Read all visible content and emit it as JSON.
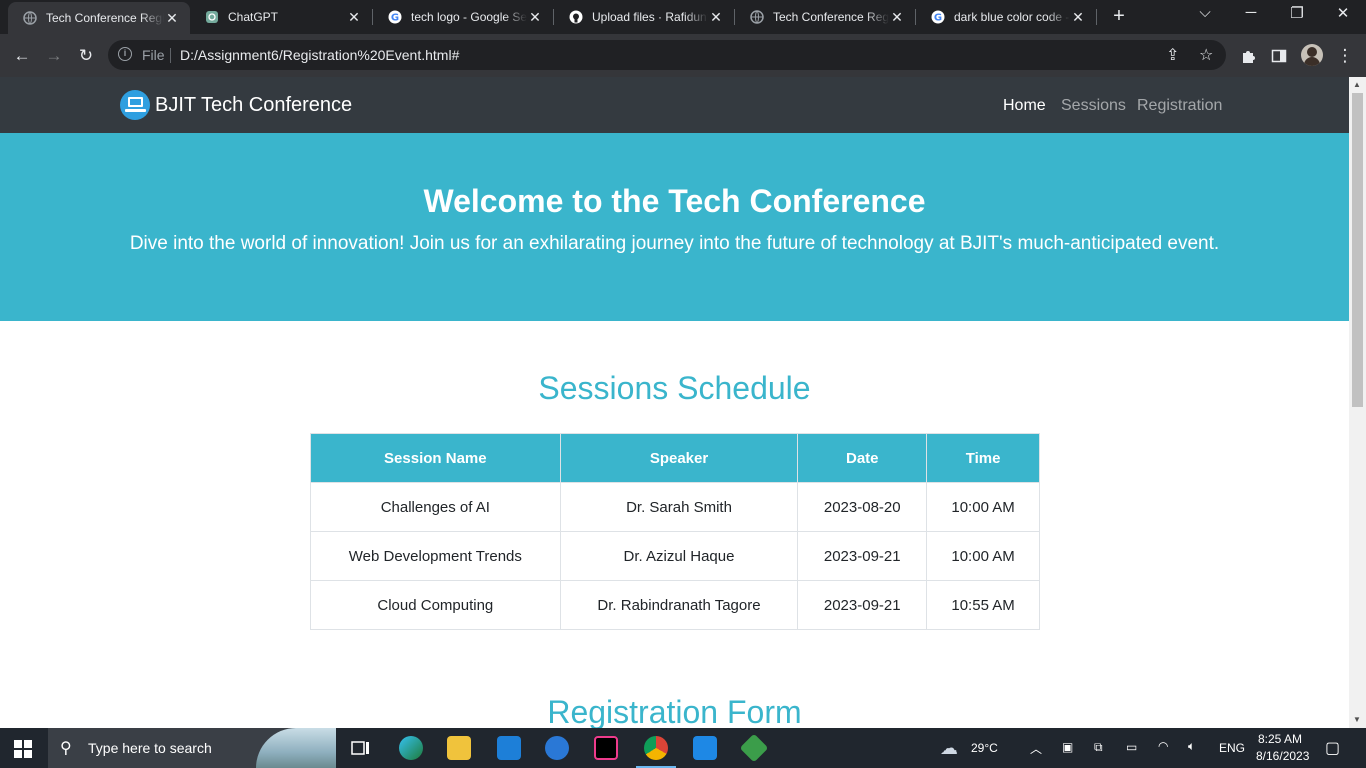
{
  "browser": {
    "tabs": [
      {
        "title": "Tech Conference Regis",
        "favicon": "globe-icon",
        "active": true
      },
      {
        "title": "ChatGPT",
        "favicon": "chatgpt-icon",
        "active": false
      },
      {
        "title": "tech logo - Google Se",
        "favicon": "google-icon",
        "active": false
      },
      {
        "title": "Upload files · Rafidunt",
        "favicon": "github-icon",
        "active": false
      },
      {
        "title": "Tech Conference Regis",
        "favicon": "globe-icon",
        "active": false
      },
      {
        "title": "dark blue color code -",
        "favicon": "google-icon",
        "active": false
      }
    ],
    "address": {
      "scheme_label": "File",
      "url": "D:/Assignment6/Registration%20Event.html#"
    }
  },
  "site": {
    "brand": "BJIT Tech Conference",
    "nav": {
      "home": "Home",
      "sessions": "Sessions",
      "registration": "Registration"
    },
    "hero": {
      "title": "Welcome to the Tech Conference",
      "subtitle": "Dive into the world of innovation! Join us for an exhilarating journey into the future of technology at BJIT's much-anticipated event."
    },
    "sessions_title": "Sessions Schedule",
    "table": {
      "headers": [
        "Session Name",
        "Speaker",
        "Date",
        "Time"
      ],
      "rows": [
        [
          "Challenges of AI",
          "Dr. Sarah Smith",
          "2023-08-20",
          "10:00 AM"
        ],
        [
          "Web Development Trends",
          "Dr. Azizul Haque",
          "2023-09-21",
          "10:00 AM"
        ],
        [
          "Cloud Computing",
          "Dr. Rabindranath Tagore",
          "2023-09-21",
          "10:55 AM"
        ]
      ]
    },
    "registration_title": "Registration Form"
  },
  "taskbar": {
    "search_placeholder": "Type here to search",
    "weather": "29°C",
    "language": "ENG",
    "time": "8:25 AM",
    "date": "8/16/2023"
  },
  "colors": {
    "accent": "#3ab5cc",
    "navbar": "#343a40"
  }
}
